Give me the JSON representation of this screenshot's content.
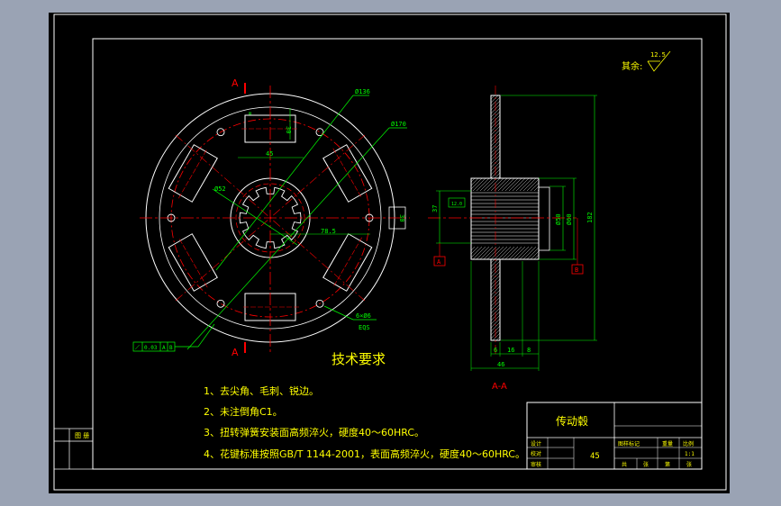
{
  "colors": {
    "background": "#9aa3b4",
    "paper": "#000000",
    "frame": "#ffffff",
    "geometry": "#ffffff",
    "center_lines": "#ff0000",
    "dimensions": "#00ff00",
    "section_marks": "#ff0000",
    "notes": "#ffff00"
  },
  "roughness": {
    "label": "其余:",
    "value": "12.5"
  },
  "section": {
    "marker_top": "A",
    "marker_bottom": "A",
    "view_title": "A-A"
  },
  "front_view_dims": {
    "diameter_outer": "Ø170",
    "diameter_pitch": "Ø136",
    "diameter_hub": "Ø52",
    "width_top_slot": "45",
    "height_top_slot": "30",
    "right_slot_height": "30",
    "radius_slot": "78.5",
    "hole_spec": "6×Ø6",
    "hole_depth": "EQS",
    "slot_note": "≡"
  },
  "section_view_dims": {
    "hub_diameter": "37",
    "spline_major": "Ø60",
    "spline_minor": "Ø50",
    "outer_diameter": "182",
    "thk_a": "6",
    "thk_b": "16",
    "thk_c": "8",
    "overall_width": "46",
    "datum": "A",
    "datum_b": "B",
    "gdt_value": "12.0"
  },
  "gdt_frame": {
    "symbol": "⟋",
    "value": "0.03",
    "datum_a": "A",
    "datum_b": "B"
  },
  "notes": {
    "title": "技术要求",
    "items": [
      "1、去尖角、毛刺、锐边。",
      "2、未注倒角C1。",
      "3、扭转弹簧安装面高频淬火，硬度40～60HRC。",
      "4、花键标准按照GB/T 1144-2001，表面高频淬火，硬度40～60HRC。"
    ]
  },
  "title_block": {
    "part_name": "传动毂",
    "material": "45",
    "row_labels": [
      "设计",
      "校对",
      "审核"
    ],
    "header_labels": [
      "图样标记",
      "重量",
      "比例"
    ],
    "scale": "1:1",
    "sheet_labels": [
      "共",
      "张",
      "第",
      "张"
    ]
  },
  "left_stub": {
    "label": "图 册"
  }
}
